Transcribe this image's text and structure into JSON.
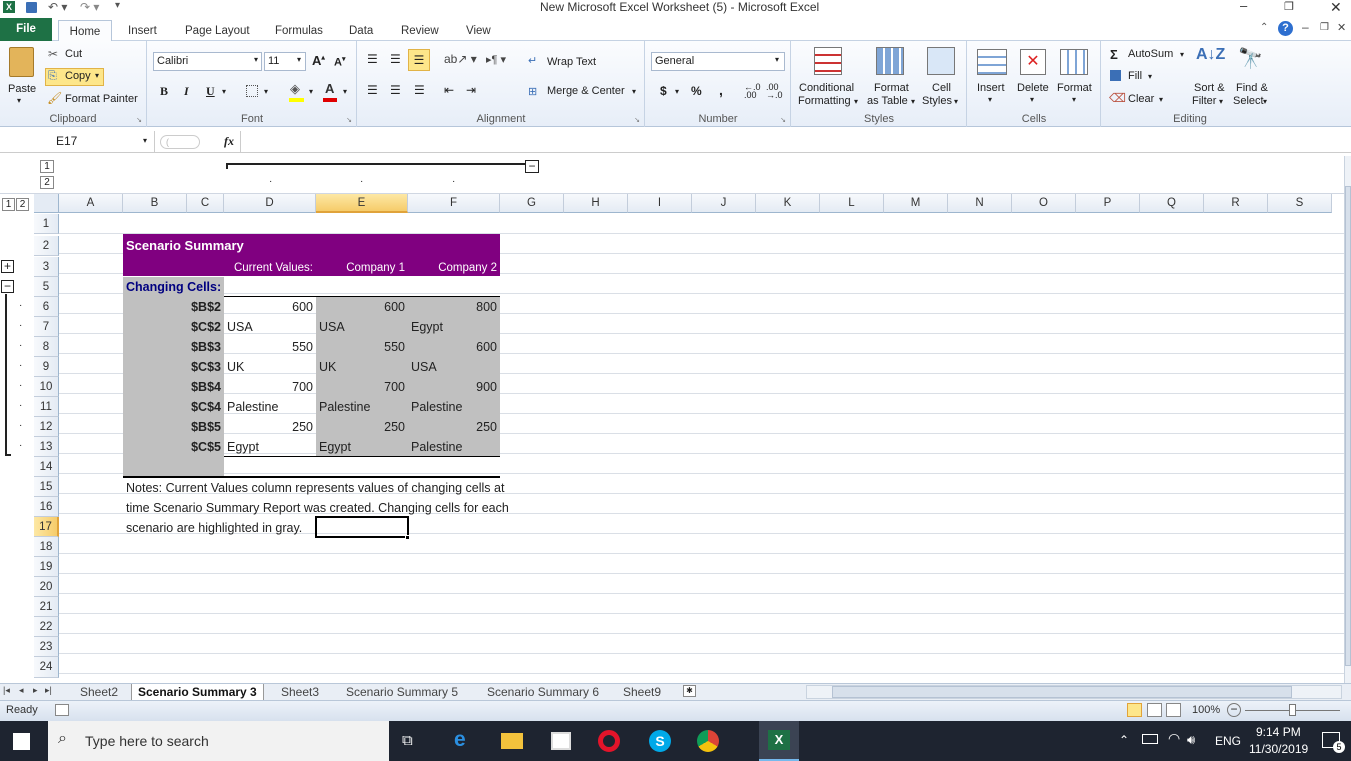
{
  "window": {
    "title": "New Microsoft Excel Worksheet (5)  -  Microsoft Excel"
  },
  "ribbon_tabs": [
    "File",
    "Home",
    "Insert",
    "Page Layout",
    "Formulas",
    "Data",
    "Review",
    "View"
  ],
  "clipboard": {
    "paste": "Paste",
    "cut": "Cut",
    "copy": "Copy",
    "format_painter": "Format Painter",
    "label": "Clipboard"
  },
  "font": {
    "name": "Calibri",
    "size": "11",
    "label": "Font",
    "bold": "B",
    "italic": "I",
    "underline": "U"
  },
  "alignment": {
    "wrap": "Wrap Text",
    "merge": "Merge & Center",
    "label": "Alignment"
  },
  "number": {
    "format": "General",
    "currency": "$",
    "percent": "%",
    "comma": ",",
    "label": "Number"
  },
  "styles": {
    "conditional": "Conditional",
    "conditional2": "Formatting",
    "format_table": "Format",
    "format_table2": "as Table",
    "cell_styles": "Cell",
    "cell_styles2": "Styles",
    "label": "Styles"
  },
  "cells": {
    "insert": "Insert",
    "delete": "Delete",
    "format": "Format",
    "label": "Cells"
  },
  "editing": {
    "autosum": "AutoSum",
    "fill": "Fill",
    "clear": "Clear",
    "sort": "Sort &",
    "sort2": "Filter",
    "find": "Find &",
    "find2": "Select",
    "label": "Editing"
  },
  "formula_bar": {
    "name_box": "E17",
    "fx": "fx",
    "formula": ""
  },
  "outline": {
    "levels_row": [
      "1",
      "2"
    ],
    "levels_col": [
      "1",
      "2"
    ]
  },
  "columns": [
    "A",
    "B",
    "C",
    "D",
    "E",
    "F",
    "G",
    "H",
    "I",
    "J",
    "K",
    "L",
    "M",
    "N",
    "O",
    "P",
    "Q",
    "R",
    "S"
  ],
  "rows": [
    "1",
    "2",
    "3",
    "5",
    "6",
    "7",
    "8",
    "9",
    "10",
    "11",
    "12",
    "13",
    "14",
    "15",
    "16",
    "17",
    "18",
    "19",
    "20",
    "21",
    "22",
    "23",
    "24"
  ],
  "summary": {
    "title": "Scenario Summary",
    "headers": [
      "Current Values:",
      "Company 1",
      "Company 2"
    ],
    "changing_cells_label": "Changing Cells:",
    "data": [
      {
        "ref": "$B$2",
        "cur": "600",
        "c1": "600",
        "c2": "800",
        "align": "r"
      },
      {
        "ref": "$C$2",
        "cur": "USA",
        "c1": "USA",
        "c2": "Egypt",
        "align": "l"
      },
      {
        "ref": "$B$3",
        "cur": "550",
        "c1": "550",
        "c2": "600",
        "align": "r"
      },
      {
        "ref": "$C$3",
        "cur": "UK",
        "c1": "UK",
        "c2": "USA",
        "align": "l"
      },
      {
        "ref": "$B$4",
        "cur": "700",
        "c1": "700",
        "c2": "900",
        "align": "r"
      },
      {
        "ref": "$C$4",
        "cur": "Palestine",
        "c1": "Palestine",
        "c2": "Palestine",
        "align": "l"
      },
      {
        "ref": "$B$5",
        "cur": "250",
        "c1": "250",
        "c2": "250",
        "align": "r"
      },
      {
        "ref": "$C$5",
        "cur": "Egypt",
        "c1": "Egypt",
        "c2": "Palestine",
        "align": "l"
      }
    ],
    "notes": [
      "Notes:  Current Values column represents values of changing cells at",
      "time Scenario Summary Report was created.  Changing cells for each",
      "scenario are highlighted in gray."
    ]
  },
  "sheet_tabs": [
    "Sheet2",
    "Scenario Summary 3",
    "Sheet3",
    "Scenario Summary 5",
    "Scenario Summary 6",
    "Sheet9"
  ],
  "status": {
    "ready": "Ready",
    "zoom": "100%"
  },
  "taskbar": {
    "search": "Type here to search",
    "lang": "ENG",
    "time": "9:14 PM",
    "date": "11/30/2019",
    "notif": "5"
  },
  "colors": {
    "title_bg": "#800080",
    "gray": "#c0c0c0",
    "file_tab": "#1e7145",
    "selection": "#000000"
  }
}
